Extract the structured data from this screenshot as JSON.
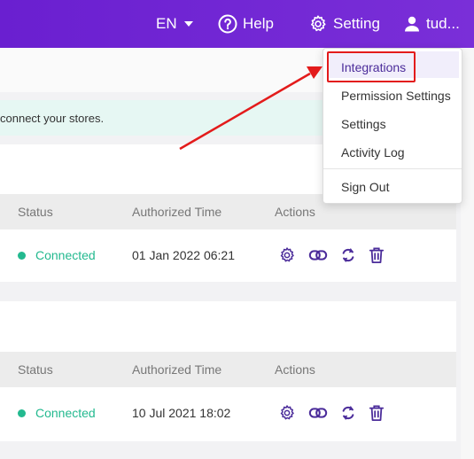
{
  "topbar": {
    "language": "EN",
    "help": "Help",
    "setting": "Setting",
    "user": "tud..."
  },
  "notice": {
    "text": "connect your stores."
  },
  "table": {
    "headers": {
      "status": "Status",
      "time": "Authorized Time",
      "actions": "Actions"
    },
    "rows": [
      {
        "status": "Connected",
        "time": "01 Jan 2022 06:21"
      },
      {
        "status": "Connected",
        "time": "10 Jul 2021 18:02"
      }
    ]
  },
  "menu": {
    "items": [
      "Integrations",
      "Permission Settings",
      "Settings",
      "Activity Log",
      "Sign Out"
    ]
  },
  "colors": {
    "topbar": "#6a1fd0",
    "accent": "#4b2c9a",
    "connected": "#23b98f",
    "annotation": "#e31b1b"
  }
}
